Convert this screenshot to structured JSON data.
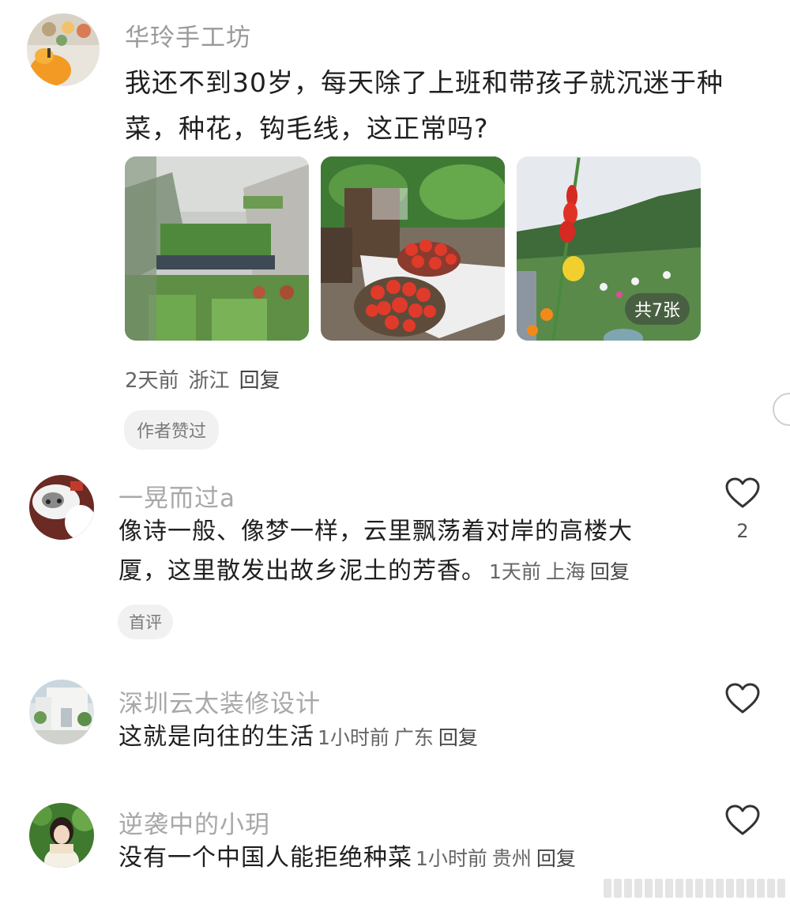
{
  "post": {
    "author": "华玲手工坊",
    "text": "我还不到30岁，每天除了上班和带孩子就沉迷于种菜，种花，钩毛线，这正常吗?",
    "photo_count_badge": "共7张",
    "time": "2天前",
    "location": "浙江",
    "reply_label": "回复",
    "tag": "作者赞过"
  },
  "comments": [
    {
      "name": "一晃而过a",
      "text": "像诗一般、像梦一样，云里飘荡着对岸的高楼大厦，这里散发出故乡泥土的芳香。",
      "time": "1天前",
      "location": "上海",
      "reply_label": "回复",
      "likes": "2",
      "tag": "首评"
    },
    {
      "name": "深圳云太装修设计",
      "text": "这就是向往的生活",
      "time": "1小时前",
      "location": "广东",
      "reply_label": "回复"
    },
    {
      "name": "逆袭中的小玥",
      "text": "没有一个中国人能拒绝种菜",
      "time": "1小时前",
      "location": "贵州",
      "reply_label": "回复"
    }
  ],
  "icons": {
    "like": "heart-outline-icon"
  },
  "colors": {
    "name_gray": "#9a9a9a",
    "text_dark": "#1f1f1f",
    "tag_bg": "#f1f1f1"
  }
}
